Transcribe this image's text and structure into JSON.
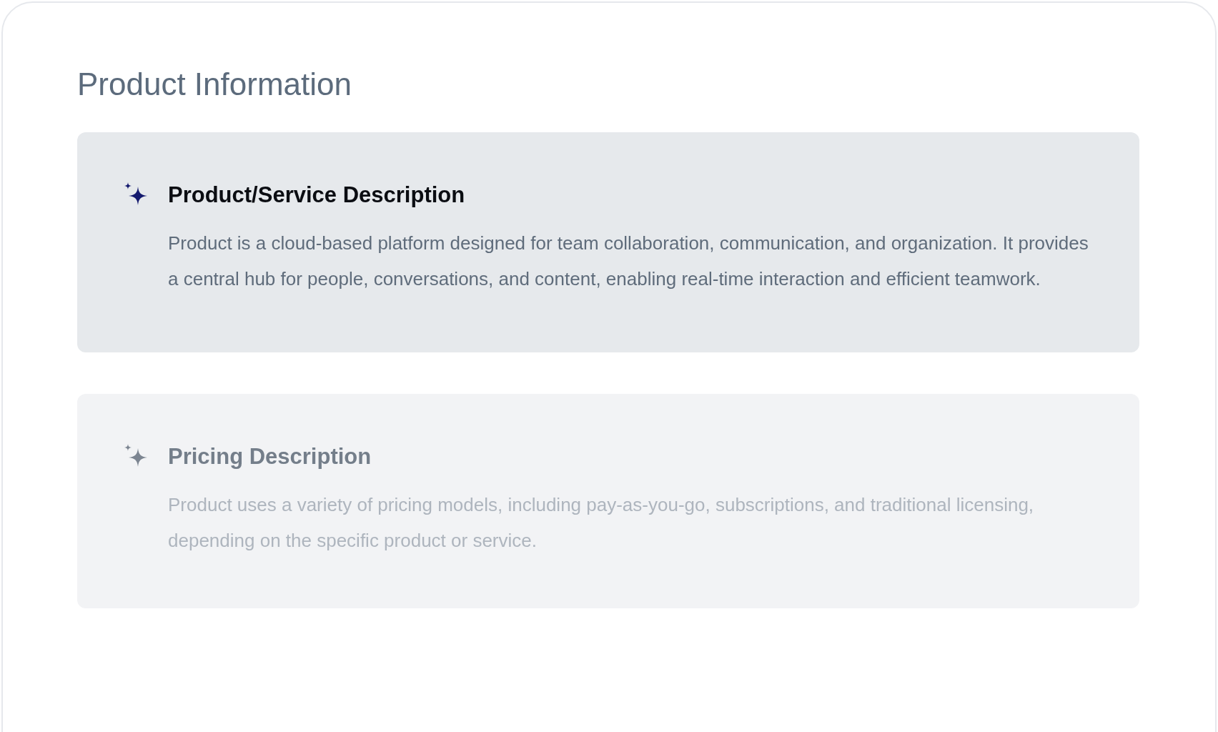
{
  "title": "Product Information",
  "sections": [
    {
      "heading": "Product/Service Description",
      "body": "Product is a cloud-based platform designed for team collaboration, communication, and organization. It provides a central hub for people, conversations, and content, enabling real-time interaction and efficient teamwork.",
      "disabled": false
    },
    {
      "heading": "Pricing Description",
      "body": "Product uses a variety of pricing models, including pay-as-you-go, subscriptions, and traditional licensing, depending on the specific product or service.",
      "disabled": true
    }
  ]
}
